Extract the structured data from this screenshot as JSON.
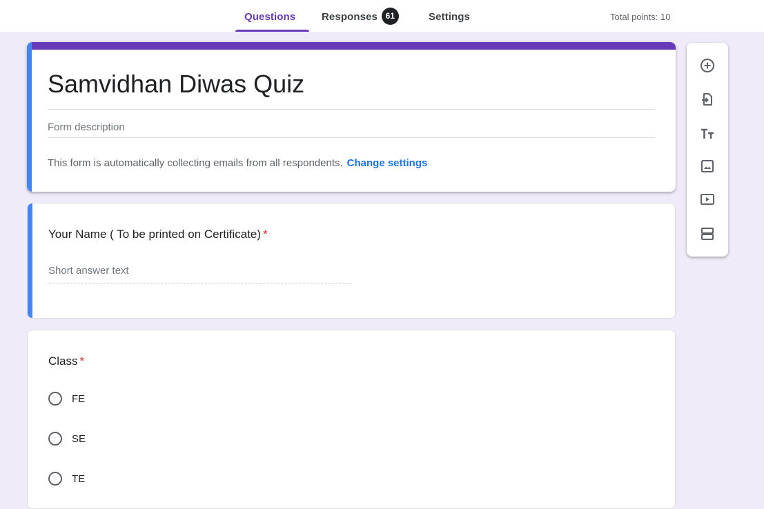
{
  "header": {
    "tabs": [
      {
        "label": "Questions",
        "active": true
      },
      {
        "label": "Responses",
        "badge": "61"
      },
      {
        "label": "Settings"
      }
    ],
    "total_points": "Total points: 10"
  },
  "form": {
    "title": "Samvidhan Diwas Quiz",
    "description_placeholder": "Form description",
    "email_note": "This form is automatically collecting emails from all respondents.",
    "change_settings_link": "Change settings"
  },
  "questions": [
    {
      "title": "Your Name ( To be printed on Certificate)",
      "required_mark": "*",
      "type": "short-answer",
      "placeholder": "Short answer text"
    },
    {
      "title": "Class",
      "required_mark": "*",
      "type": "multiple-choice",
      "options": [
        "FE",
        "SE",
        "TE"
      ]
    }
  ],
  "toolbar": {
    "icons": [
      "add-question-icon",
      "import-questions-icon",
      "add-title-icon",
      "add-image-icon",
      "add-video-icon",
      "add-section-icon"
    ]
  },
  "colors": {
    "background": "#f0ebf8",
    "theme": "#673ab7",
    "focus_accent": "#4285f4",
    "required": "#d93025",
    "link": "#1a73e8"
  }
}
